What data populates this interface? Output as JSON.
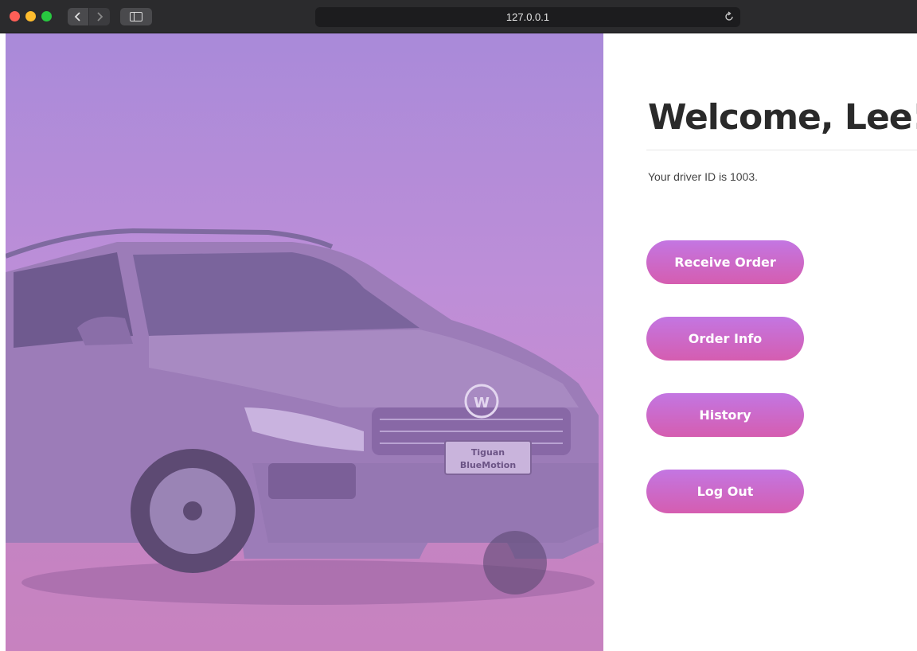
{
  "browser": {
    "url": "127.0.0.1",
    "icons": {
      "back": "chevron-left-icon",
      "forward": "chevron-right-icon",
      "sidebar": "sidebar-icon",
      "reload": "reload-icon"
    }
  },
  "hero": {
    "plate_line1": "Tiguan",
    "plate_line2": "BlueMotion"
  },
  "main": {
    "welcome": "Welcome, Lee!",
    "driver_id_text": "Your driver ID is 1003.",
    "buttons": {
      "receive_order": "Receive Order",
      "order_info": "Order Info",
      "history": "History",
      "log_out": "Log Out"
    }
  },
  "colors": {
    "button_gradient_top": "#c376e2",
    "button_gradient_bottom": "#d55db0",
    "hero_tint_top": "#a98ad9",
    "hero_tint_bottom": "#cf86c4"
  }
}
